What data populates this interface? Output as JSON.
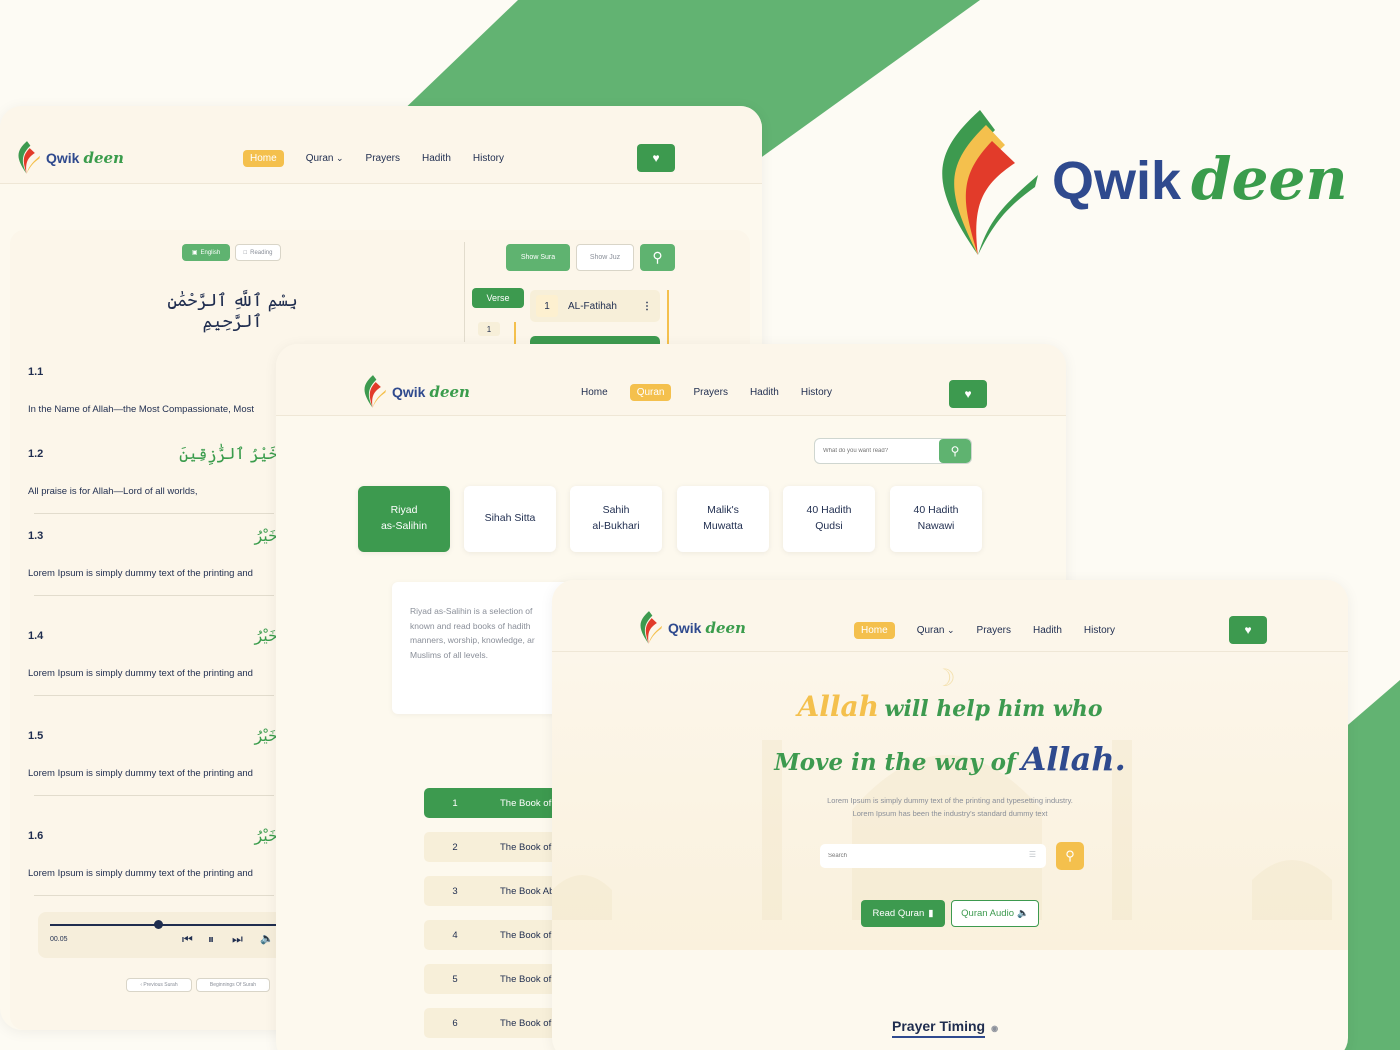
{
  "brand": {
    "name_left": "Qwik",
    "name_right": "deen",
    "colors": {
      "green": "#3d9a4f",
      "yellow": "#f4c04d",
      "navy": "#2f4a8e",
      "cream": "#fdf9ee"
    }
  },
  "nav": {
    "home": "Home",
    "quran": "Quran",
    "prayers": "Prayers",
    "hadith": "Hadith",
    "history": "History"
  },
  "quran_screen": {
    "lang_button": "English",
    "reading_button": "Reading",
    "bismillah": "بِسْمِ ٱللَّهِ ٱلرَّحْمَٰنِ ٱلرَّحِيمِ",
    "show_sura": "Show Sura",
    "show_juz": "Show Juz",
    "verse_tab": "Verse",
    "verse_list_num": "1",
    "sura_num": "1",
    "sura_name": "AL-Fatihah",
    "verses": [
      {
        "num": "1.1",
        "arabic": "",
        "text": "In the Name of Allah—the Most Compassionate, Most"
      },
      {
        "num": "1.2",
        "arabic": "خَيْرُ ٱلرَّٰزِقِينَ",
        "text": "All praise is for Allah—Lord of all worlds,"
      },
      {
        "num": "1.3",
        "arabic": "خَيْرُ",
        "text": "Lorem Ipsum is simply dummy text of the printing and"
      },
      {
        "num": "1.4",
        "arabic": "خَيْرُ",
        "text": "Lorem Ipsum is simply dummy text of the printing and"
      },
      {
        "num": "1.5",
        "arabic": "خَيْرُ",
        "text": "Lorem Ipsum is simply dummy text of the printing and"
      },
      {
        "num": "1.6",
        "arabic": "خَيْرُ",
        "text": "Lorem Ipsum is simply dummy text of the printing and"
      }
    ],
    "player": {
      "time": "00.05",
      "progress": 0.45
    },
    "prev_surah": "‹ Previous Surah",
    "beginning_surah": "Beginnings Of Surah"
  },
  "hadith_screen": {
    "search_placeholder": "What do you want read?",
    "collections": [
      {
        "line1": "Riyad",
        "line2": "as-Salihin"
      },
      {
        "line1": "Sihah Sitta",
        "line2": ""
      },
      {
        "line1": "Sahih",
        "line2": "al-Bukhari"
      },
      {
        "line1": "Malik's",
        "line2": "Muwatta"
      },
      {
        "line1": "40 Hadith",
        "line2": "Qudsi"
      },
      {
        "line1": "40 Hadith",
        "line2": "Nawawi"
      }
    ],
    "description": [
      "Riyad as-Salihin is a selection of",
      "known and read books of hadith",
      "manners, worship, knowledge, ar",
      "Muslims of all levels."
    ],
    "books": [
      {
        "n": "1",
        "t": "The Book of"
      },
      {
        "n": "2",
        "t": "The Book of"
      },
      {
        "n": "3",
        "t": "The Book Ab"
      },
      {
        "n": "4",
        "t": "The Book of"
      },
      {
        "n": "5",
        "t": "The Book of"
      },
      {
        "n": "6",
        "t": "The Book of"
      }
    ]
  },
  "home_screen": {
    "hero_line1_a": "Allah",
    "hero_line1_b": "will help him who",
    "hero_line2_a": "Move in the way of",
    "hero_line2_b": "Allah.",
    "sub1": "Lorem Ipsum is simply dummy text of the printing and typesetting industry.",
    "sub2": "Lorem Ipsum has been the industry's standard dummy text",
    "search_placeholder": "Search",
    "read_quran": "Read Quran",
    "quran_audio": "Quran Audio",
    "prayer_timing": "Prayer Timing"
  }
}
